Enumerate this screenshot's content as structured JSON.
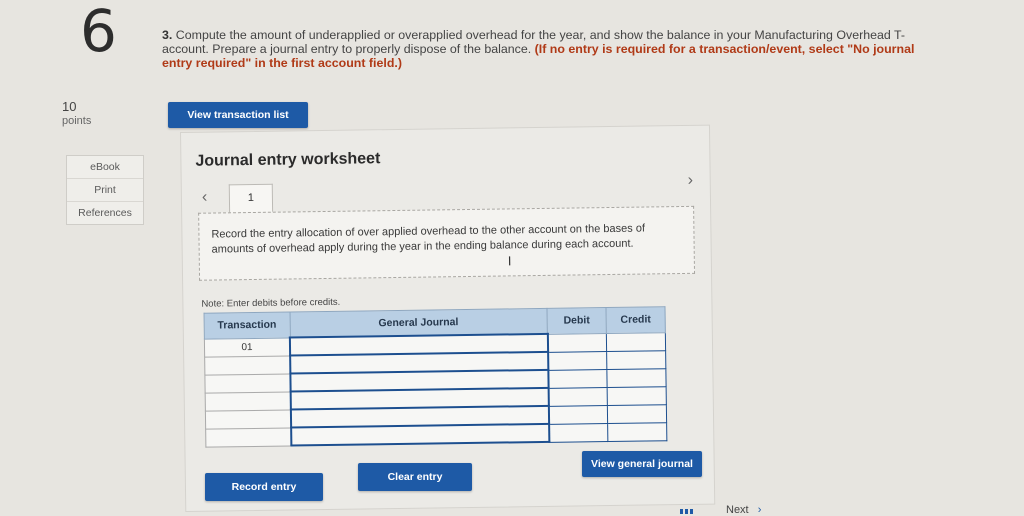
{
  "question": {
    "number": "6",
    "points_value": "10",
    "points_label": "points",
    "prompt_number": "3.",
    "prompt_text": "Compute the amount of underapplied or overapplied overhead for the year, and show the balance in your Manufacturing Overhead T-account. Prepare a journal entry to properly dispose of the balance.",
    "prompt_note": "(If no entry is required for a transaction/event, select \"No journal entry required\" in the first account field.)"
  },
  "sidebar": {
    "items": [
      {
        "label": "eBook"
      },
      {
        "label": "Print"
      },
      {
        "label": "References"
      }
    ]
  },
  "buttons": {
    "view_transaction_list": "View transaction list",
    "record_entry": "Record entry",
    "clear_entry": "Clear entry",
    "view_general_journal": "View general journal"
  },
  "worksheet": {
    "title": "Journal entry worksheet",
    "prev_icon": "chevron-left-icon",
    "next_icon": "chevron-right-icon",
    "tabs": [
      {
        "label": "1"
      }
    ],
    "instruction": "Record the entry allocation of over applied overhead to the other account on the bases of amounts of overhead apply during the year in the ending balance during each account.",
    "note": "Note: Enter debits before credits.",
    "table": {
      "headers": [
        "Transaction",
        "General Journal",
        "Debit",
        "Credit"
      ],
      "rows": [
        {
          "transaction": "01",
          "account": "",
          "debit": "",
          "credit": ""
        },
        {
          "transaction": "",
          "account": "",
          "debit": "",
          "credit": ""
        },
        {
          "transaction": "",
          "account": "",
          "debit": "",
          "credit": ""
        },
        {
          "transaction": "",
          "account": "",
          "debit": "",
          "credit": ""
        },
        {
          "transaction": "",
          "account": "",
          "debit": "",
          "credit": ""
        },
        {
          "transaction": "",
          "account": "",
          "debit": "",
          "credit": ""
        }
      ]
    }
  },
  "footer": {
    "next_label": "Next",
    "next_icon": "chevron-right-icon"
  },
  "colors": {
    "button_blue": "#1e5aa6",
    "note_red": "#b03a17",
    "header_blue": "#b9cfe4"
  }
}
